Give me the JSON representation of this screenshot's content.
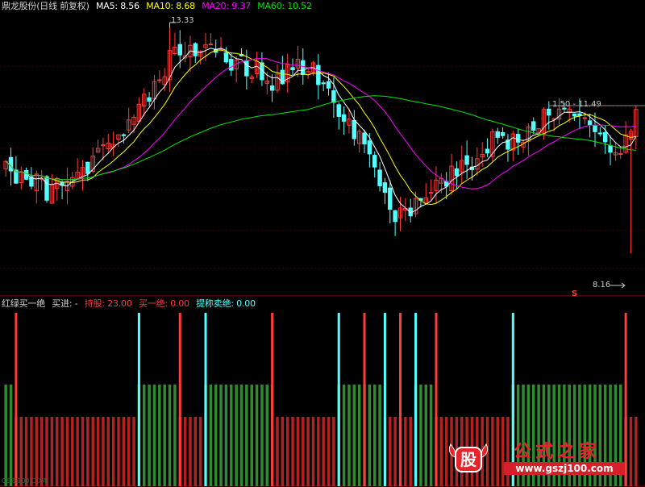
{
  "top_header": {
    "stock_label": "鼎龙股份(日线 前复权)",
    "ma5_label": "MA5: 8.56",
    "ma10_label": "MA10: 8.68",
    "ma20_label": "MA20: 9.37",
    "ma60_label": "MA60: 10.52"
  },
  "sub_header": {
    "indicator_label": "红绿买一绝",
    "buy_label": "买进: -",
    "hold_label": "持股: 23.00",
    "buy_one_label": "买一绝: 0.00",
    "sell_label": "提称卖绝: 0.00"
  },
  "annotations": {
    "high_price": "13.33",
    "price_range": "1.50 - 11.49",
    "low_price": "8.16",
    "sell_marker": "S"
  },
  "watermark": {
    "title": "公式之家",
    "url": "www.gszj100.com",
    "logo_char": "股"
  },
  "bottom_tag": "GSZJ100.COM",
  "colors": {
    "background": "#000000",
    "up_candle": "#ff3b3b",
    "down_candle": "#54ffff",
    "ma5": "#ffffff",
    "ma10": "#ffff00",
    "ma20": "#ff00ff",
    "ma60": "#00e600",
    "hold_bar": "#b22222",
    "wait_bar": "#2e8b2e",
    "grid": "#8b0000",
    "watermark_red": "#e8232a"
  },
  "chart_data": {
    "type": "candlestick",
    "price_ylim": [
      7.5,
      13.6
    ],
    "candles": [],
    "indicator": {
      "type": "bar",
      "states": [],
      "signals": []
    }
  }
}
